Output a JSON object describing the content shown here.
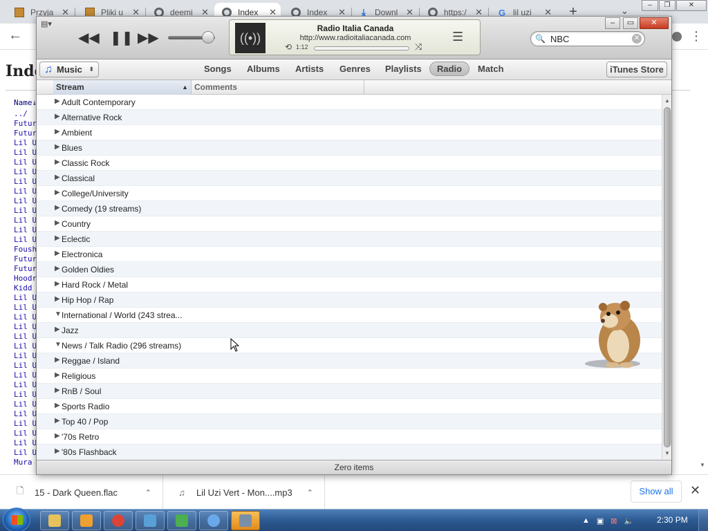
{
  "browser": {
    "tabs": [
      {
        "title": "Przyja",
        "icon": "image-favicon",
        "active": false
      },
      {
        "title": "Pliki u",
        "icon": "image-favicon",
        "active": false
      },
      {
        "title": "deemi",
        "icon": "globe-icon",
        "active": false
      },
      {
        "title": "Index",
        "icon": "globe-icon",
        "active": true
      },
      {
        "title": "Index",
        "icon": "globe-icon",
        "active": false
      },
      {
        "title": "Downl",
        "icon": "download-icon",
        "active": false
      },
      {
        "title": "https:/",
        "icon": "globe-icon",
        "active": false
      },
      {
        "title": "lil uzi",
        "icon": "google-icon",
        "active": false
      }
    ],
    "new_tab_glyph": "+",
    "page": {
      "heading": "Inde",
      "column_header": "Name↓",
      "entries": [
        "../",
        "Futur",
        "Futur",
        "Lil U",
        "Lil U",
        "Lil U",
        "Lil U",
        "Lil U",
        "Lil U",
        "Lil U",
        "Lil U",
        "Lil U",
        "Lil U",
        "Lil U",
        "Foush",
        "Futur",
        "Futur",
        "Hoodr",
        "Kidd ",
        "Lil U",
        "Lil U",
        "Lil U",
        "Lil U",
        "Lil U",
        "Lil U",
        "Lil U",
        "Lil U",
        "Lil U",
        "Lil U",
        "Lil U",
        "Lil U",
        "Lil U",
        "Lil U",
        "Lil U",
        "Lil U",
        "Lil U",
        "Mura "
      ]
    },
    "downloads": [
      {
        "name": "15 - Dark Queen.flac",
        "icon": "file-icon"
      },
      {
        "name": "Lil Uzi Vert - Mon....mp3",
        "icon": "music-file-icon"
      }
    ],
    "show_all_label": "Show all"
  },
  "itunes": {
    "now_playing": {
      "title": "Radio Italia Canada",
      "url": "http://www.radioitaliacanada.com",
      "elapsed": "1:12",
      "volume_fraction": 0.85
    },
    "search": {
      "value": "NBC"
    },
    "media_picker_label": "Music",
    "nav_tabs": [
      "Songs",
      "Albums",
      "Artists",
      "Genres",
      "Playlists",
      "Radio",
      "Match"
    ],
    "selected_tab": "Radio",
    "store_label": "iTunes Store",
    "columns": {
      "stream": "Stream",
      "comments": "Comments"
    },
    "genres": [
      {
        "name": "Adult Contemporary",
        "expanded": false
      },
      {
        "name": "Alternative Rock",
        "expanded": false
      },
      {
        "name": "Ambient",
        "expanded": false
      },
      {
        "name": "Blues",
        "expanded": false
      },
      {
        "name": "Classic Rock",
        "expanded": false
      },
      {
        "name": "Classical",
        "expanded": false
      },
      {
        "name": "College/University",
        "expanded": false
      },
      {
        "name": "Comedy (19 streams)",
        "expanded": false
      },
      {
        "name": "Country",
        "expanded": false
      },
      {
        "name": "Eclectic",
        "expanded": false
      },
      {
        "name": "Electronica",
        "expanded": false
      },
      {
        "name": "Golden Oldies",
        "expanded": false
      },
      {
        "name": "Hard Rock / Metal",
        "expanded": false
      },
      {
        "name": "Hip Hop / Rap",
        "expanded": false
      },
      {
        "name": "International / World (243 strea...",
        "expanded": true
      },
      {
        "name": "Jazz",
        "expanded": false
      },
      {
        "name": "News / Talk Radio (296 streams)",
        "expanded": true
      },
      {
        "name": "Reggae / Island",
        "expanded": false
      },
      {
        "name": "Religious",
        "expanded": false
      },
      {
        "name": "RnB / Soul",
        "expanded": false
      },
      {
        "name": "Sports Radio",
        "expanded": false
      },
      {
        "name": "Top 40 / Pop",
        "expanded": false
      },
      {
        "name": "'70s Retro",
        "expanded": false
      },
      {
        "name": "'80s Flashback",
        "expanded": false
      }
    ],
    "status": "Zero items"
  },
  "taskbar": {
    "clock": "2:30 PM",
    "apps": [
      {
        "icon": "folder-icon",
        "active": false
      },
      {
        "icon": "media-player-icon",
        "active": false
      },
      {
        "icon": "chrome-icon",
        "active": false
      },
      {
        "icon": "network-icon",
        "active": false
      },
      {
        "icon": "puzzle-icon",
        "active": false
      },
      {
        "icon": "itunes-icon",
        "active": false
      },
      {
        "icon": "window-icon",
        "active": true
      }
    ]
  },
  "colors": {
    "itunes_selected_tab": "#bdbdbd",
    "row_alt": "#f1f5fa",
    "taskbar": "#2c5a92",
    "link": "#1a0dab",
    "download_accent": "#1a73e8"
  }
}
